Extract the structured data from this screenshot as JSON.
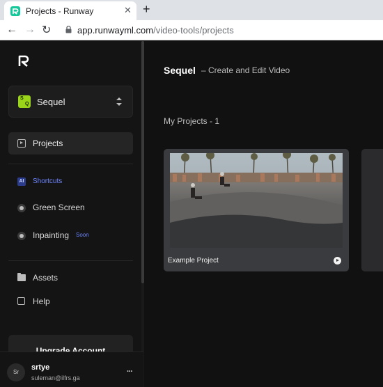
{
  "browser": {
    "tab_title": "Projects - Runway",
    "tab_close": "✕",
    "new_tab": "+",
    "url_host": "app.runwayml.com",
    "url_path": "/video-tools/projects"
  },
  "sidebar": {
    "logo": "runway-logo",
    "workspace": {
      "badge_letters": [
        "S",
        "Q"
      ],
      "name": "Sequel",
      "badge_color": "#9ad51a"
    },
    "projects_label": "Projects",
    "shortcuts": {
      "badge": "AI",
      "label": "Shortcuts"
    },
    "tools": [
      {
        "label": "Green Screen",
        "tag": ""
      },
      {
        "label": "Inpainting",
        "tag": "Soon"
      }
    ],
    "links": [
      {
        "label": "Assets",
        "icon": "folder-icon"
      },
      {
        "label": "Help",
        "icon": "help-icon"
      }
    ],
    "upgrade_label": "Upgrade Account",
    "user": {
      "initials": "Sr",
      "name": "srtye",
      "email": "suleman@ilfrs.ga",
      "menu": "···"
    }
  },
  "main": {
    "title": "Sequel",
    "subtitle": "– Create and Edit Video",
    "projects_heading": "My Projects - 1",
    "projects": [
      {
        "name": "Example Project"
      }
    ]
  },
  "colors": {
    "accent_green": "#16c79a",
    "link_blue": "#6e86ff",
    "background": "#111111"
  }
}
